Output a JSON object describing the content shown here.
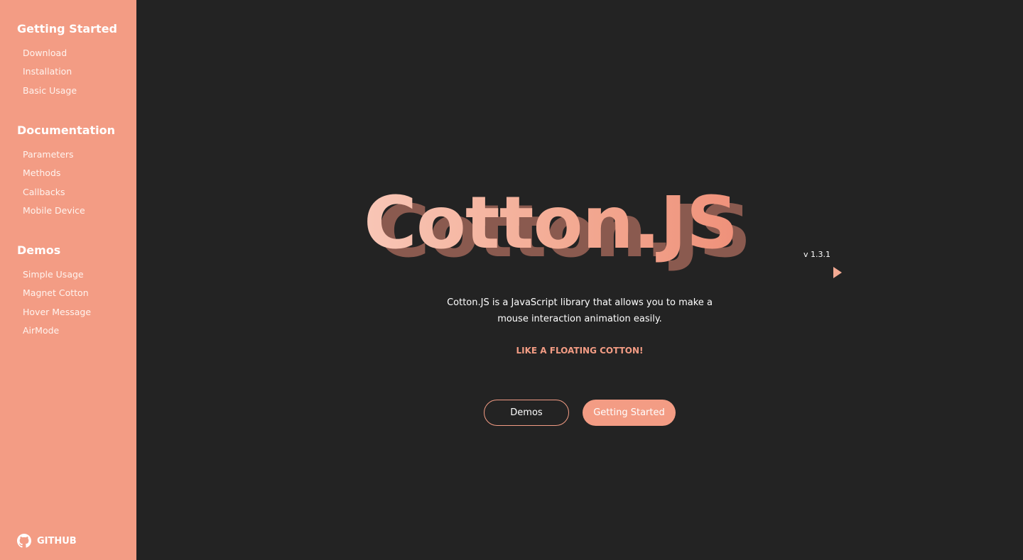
{
  "sidebar": {
    "sections": [
      {
        "heading": "Getting Started",
        "items": [
          "Download",
          "Installation",
          "Basic Usage"
        ]
      },
      {
        "heading": "Documentation",
        "items": [
          "Parameters",
          "Methods",
          "Callbacks",
          "Mobile Device"
        ]
      },
      {
        "heading": "Demos",
        "items": [
          "Simple Usage",
          "Magnet Cotton",
          "Hover Message",
          "AirMode"
        ]
      }
    ],
    "github_label": "GITHUB"
  },
  "hero": {
    "title": "Cotton.JS",
    "version": "v 1.3.1",
    "description_line1": "Cotton.JS is a JavaScript library that allows you to make a",
    "description_line2": "mouse interaction animation easily.",
    "tagline": "LIKE A FLOATING COTTON!"
  },
  "buttons": {
    "demos_label": "Demos",
    "getting_started_label": "Getting Started"
  },
  "colors": {
    "accent": "#f39c84",
    "background": "#232323",
    "title_shadow": "#8a5a4f"
  },
  "icons": {
    "github": "github-icon",
    "cursor": "cursor-arrow-icon"
  }
}
